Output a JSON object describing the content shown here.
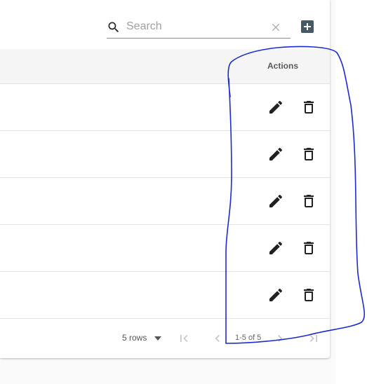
{
  "toolbar": {
    "search_placeholder": "Search",
    "search_value": ""
  },
  "table": {
    "header": {
      "actions_label": "Actions"
    },
    "rows_count": 5
  },
  "footer": {
    "rows_per_page_label": "5 rows",
    "page_info": "1-5 of 5"
  },
  "icons": {
    "search": "search-icon",
    "clear": "close-icon",
    "add": "add-box-icon",
    "edit": "pencil-icon",
    "delete": "trash-icon",
    "rows_dropdown": "caret-down-icon",
    "first_page": "first-page-icon",
    "previous_page": "chevron-left-icon",
    "next_page": "chevron-right-icon",
    "last_page": "last-page-icon"
  },
  "colors": {
    "add_button": "#455a64",
    "icon_dark": "#212121",
    "annotation_stroke": "#1a2bd6",
    "header_bg": "#f5f5f5"
  }
}
